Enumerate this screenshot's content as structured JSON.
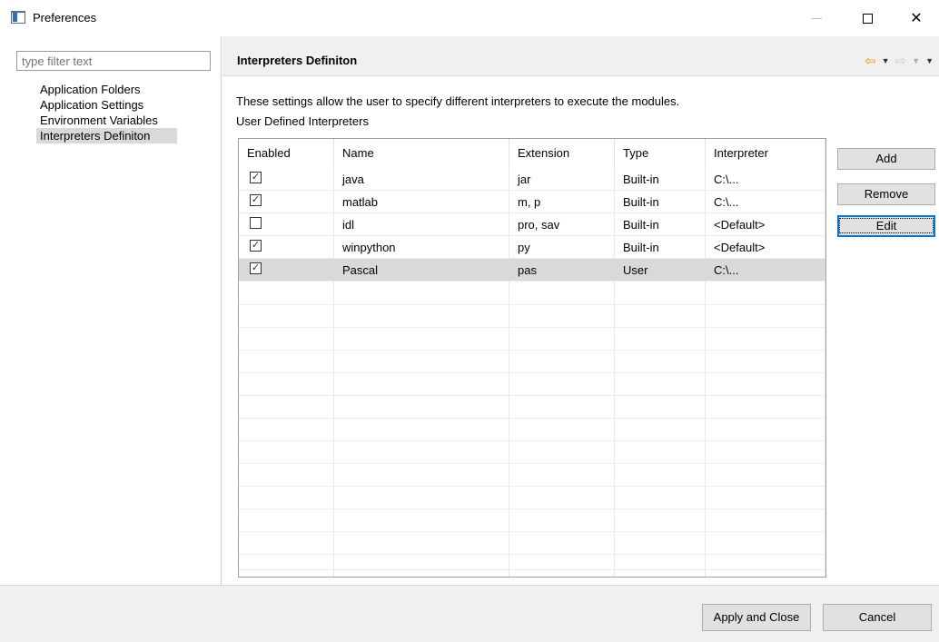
{
  "window": {
    "title": "Preferences"
  },
  "sidebar": {
    "filter_placeholder": "type filter text",
    "items": [
      {
        "label": "Application Folders",
        "selected": false
      },
      {
        "label": "Application Settings",
        "selected": false
      },
      {
        "label": "Environment Variables",
        "selected": false
      },
      {
        "label": "Interpreters Definiton",
        "selected": true
      }
    ]
  },
  "page": {
    "title": "Interpreters Definiton",
    "description": "These settings allow the user to specify different interpreters to execute the modules.",
    "section_label": "User Defined Interpreters"
  },
  "table": {
    "columns": [
      "Enabled",
      "Name",
      "Extension",
      "Type",
      "Interpreter"
    ],
    "rows": [
      {
        "enabled": true,
        "name": "java",
        "extension": "jar",
        "type": "Built-in",
        "interpreter": "C:\\..."
      },
      {
        "enabled": true,
        "name": "matlab",
        "extension": "m, p",
        "type": "Built-in",
        "interpreter": "C:\\..."
      },
      {
        "enabled": false,
        "name": "idl",
        "extension": "pro, sav",
        "type": "Built-in",
        "interpreter": "<Default>"
      },
      {
        "enabled": true,
        "name": "winpython",
        "extension": "py",
        "type": "Built-in",
        "interpreter": "<Default>"
      },
      {
        "enabled": true,
        "name": "Pascal",
        "extension": "pas",
        "type": "User",
        "interpreter": "C:\\..."
      }
    ],
    "selected_row": 4
  },
  "buttons": {
    "add": "Add",
    "remove": "Remove",
    "edit": "Edit",
    "apply_close": "Apply and Close",
    "cancel": "Cancel"
  },
  "colors": {
    "back_arrow": "#e8a300",
    "selection": "#d9d9d9",
    "focus": "#0078d7"
  }
}
